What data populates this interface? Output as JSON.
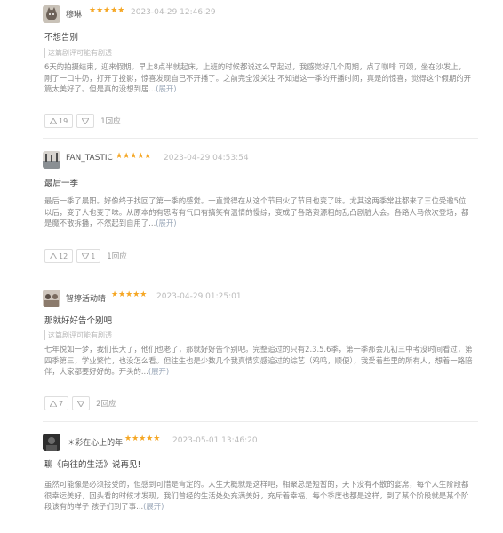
{
  "colors": {
    "star": "#f5a623",
    "body_text": "#888888",
    "link": "#9aa7b8"
  },
  "reviews": [
    {
      "username": "穆琳",
      "stars": "★★★★★",
      "timestamp": "2023-04-29 12:46:29",
      "title": "不想告别",
      "tag": "这篇剧评可能有剧透",
      "body": "6天的拍摄结束，迎来假期。早上8点半就起床，上班的时候都说这么早起过，我感觉好几个周期，点了咖啡 可颂，坐在沙发上，刚了一口牛奶，打开了投影，惊喜发现自己不开播了。之前完全没关注 不知道这一季的开播时间，真是的惊喜，觉得这个假期的开篇太美好了。但是真的没想到居...",
      "expand": "(展开)",
      "likes": "19",
      "dislikes": "",
      "reply": "1回应",
      "avatar": "cat-avatar-icon"
    },
    {
      "username": "FAN_TASTIC",
      "stars": "★★★★★",
      "timestamp": "2023-04-29 04:53:54",
      "title": "最后一季",
      "tag": "",
      "body": "最后一季了晨阳。好像终于找回了第一季的感觉。一直觉得在从这个节目火了节目也变了味。尤其这两季常驻都来了三位受邀5位以后，变了人也变了味。从原本的有思考有气口有搞笑有温情的慢综，变成了各路资源粗的乱凸剧脏大会。各路人马依次登场，都是魔不散拆播，不然起到自用了...",
      "expand": "(展开)",
      "likes": "12",
      "dislikes": "1",
      "reply": "1回应",
      "avatar": "landscape-avatar-icon"
    },
    {
      "username": "智婷活动睛",
      "stars": "★★★★★",
      "timestamp": "2023-04-29 01:25:01",
      "title": "那就好好告个别吧",
      "tag": "这篇剧评可能有剧透",
      "body": "七年悦如一梦，我们长大了，他们也老了，那就好好告个别吧。完整追过的只有2.3.5.6季，第一季那会儿初三中考没时间看过，第四季第三，学业繁忙，也没怎么看。但往生也是少数几个我真情实感追过的综艺（鸡鸣，顺便），我爱着些里的所有人，想着一路陪伴，大家都要好好的。开头的...",
      "expand": "(展开)",
      "likes": "7",
      "dislikes": "",
      "reply": "2回应",
      "avatar": "group-avatar-icon"
    },
    {
      "username": "☀彩在心上的年",
      "stars": "★★★★★",
      "timestamp": "2023-05-01 13:46:20",
      "title": "聊《向往的生活》说再见!",
      "tag": "",
      "body": "虽然可能像是必须接受的，但感到可惜是肯定的。人生大概就是这样吧，相聚总是短暂的，天下没有不散的宴席，每个人生阶段都很幸运美好，回头看的时候才发现，我们曾经的生活处处充满美好，充斥着幸福，每个季度也都是这样，到了某个阶段就是某个阶段该有的样子 孩子们到了事...",
      "expand": "(展开)",
      "likes": "",
      "dislikes": "",
      "reply": "",
      "avatar": "dark-avatar-icon"
    }
  ]
}
